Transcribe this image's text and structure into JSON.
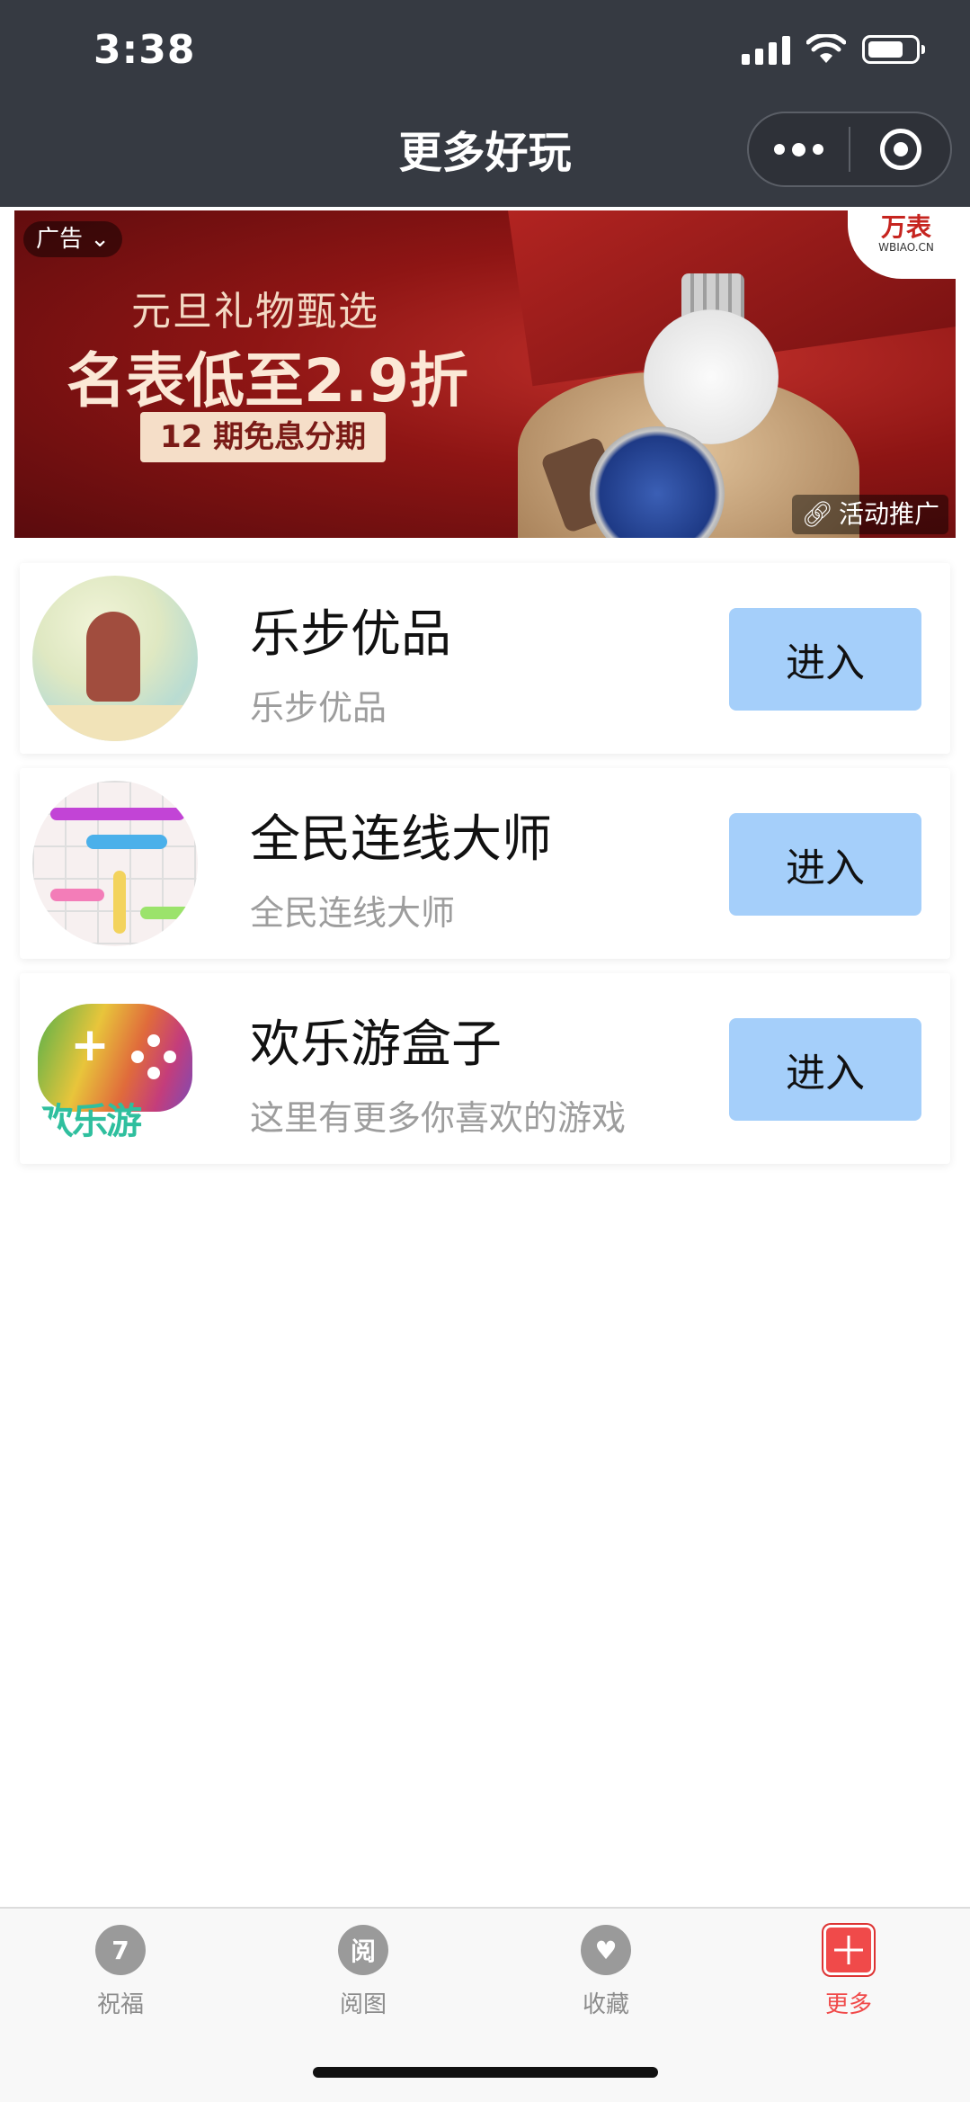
{
  "status_bar": {
    "time": "3:38"
  },
  "header": {
    "title": "更多好玩"
  },
  "ad": {
    "tag": "广告",
    "subtitle": "元旦礼物甄选",
    "headline": "名表低至2.9折",
    "pill": "12 期免息分期",
    "brand_name": "万表",
    "brand_domain": "WBIAO.CN",
    "promo": "活动推广"
  },
  "items": [
    {
      "title": "乐步优品",
      "desc": "乐步优品",
      "button": "进入"
    },
    {
      "title": "全民连线大师",
      "desc": "全民连线大师",
      "button": "进入"
    },
    {
      "title": "欢乐游盒子",
      "desc": "这里有更多你喜欢的游戏",
      "button": "进入",
      "logo_text": "欢乐游"
    }
  ],
  "tabbar": {
    "tabs": [
      {
        "label": "祝福",
        "icon": "calendar-icon",
        "glyph": "7"
      },
      {
        "label": "阅图",
        "icon": "read-icon",
        "glyph": "阅"
      },
      {
        "label": "收藏",
        "icon": "heart-icon",
        "glyph": "♥"
      },
      {
        "label": "更多",
        "icon": "more-grid-icon",
        "glyph": ""
      }
    ],
    "active_color": "#f04a4a"
  }
}
